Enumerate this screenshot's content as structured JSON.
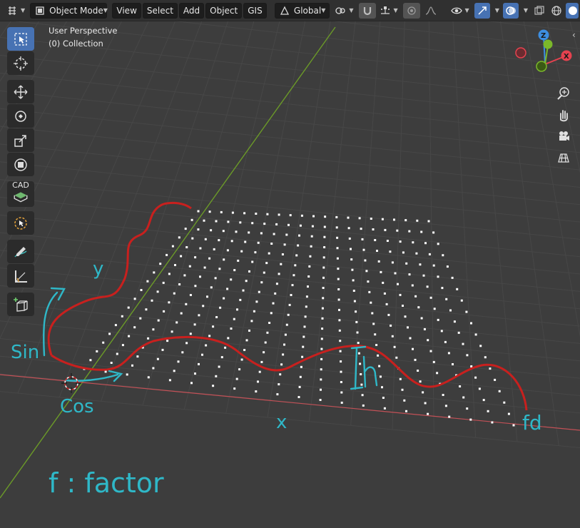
{
  "header": {
    "editor_type_icon": "viewport-icon",
    "mode": {
      "label": "Object Mode",
      "icon": "object-mode-icon"
    },
    "menus": [
      "View",
      "Select",
      "Add",
      "Object",
      "GIS"
    ],
    "transform_orientation": {
      "label": "Global",
      "icon": "orientation-icon"
    },
    "pivot_icon": "pivot-icon",
    "snap_icon": "magnet-icon",
    "snap_target_icon": "snap-grid-icon",
    "proportional_icon": "proportional-edit-icon",
    "falloff_icon": "falloff-curve-icon",
    "visibility_icon": "eye-icon",
    "gizmo_icon": "gizmo-icon",
    "overlay_icon": "overlay-icon",
    "xray_icon": "xray-icon",
    "wireframe_icon": "wireframe-shading-icon",
    "solid_icon": "solid-shading-icon"
  },
  "viewport": {
    "perspective_label": "User Perspective",
    "collection_label": "(0) Collection"
  },
  "toolbar": {
    "tools": [
      {
        "name": "select-box-tool",
        "icon": "select-box-icon",
        "active": true
      },
      {
        "name": "cursor-tool",
        "icon": "cursor-icon",
        "active": false
      },
      {
        "name": "move-tool",
        "icon": "move-icon",
        "active": false
      },
      {
        "name": "rotate-tool",
        "icon": "rotate-icon",
        "active": false
      },
      {
        "name": "scale-tool",
        "icon": "scale-icon",
        "active": false
      },
      {
        "name": "transform-tool",
        "icon": "transform-icon",
        "active": false
      },
      {
        "name": "cad-tool",
        "icon": "cad-icon",
        "label": "CAD",
        "active": false
      },
      {
        "name": "select-circle-tool",
        "icon": "select-circle-icon",
        "active": false
      },
      {
        "name": "annotate-tool",
        "icon": "annotate-icon",
        "active": false
      },
      {
        "name": "measure-tool",
        "icon": "measure-icon",
        "active": false
      },
      {
        "name": "add-cube-tool",
        "icon": "add-cube-icon",
        "active": false
      }
    ]
  },
  "navigation": {
    "gizmo_axes": {
      "z": "Z",
      "x": "X"
    },
    "buttons": [
      "zoom-icon",
      "pan-hand-icon",
      "camera-icon",
      "ortho-grid-icon"
    ]
  },
  "annotations": {
    "labels": [
      "y",
      "Sin",
      "Cos",
      "x",
      "h",
      "fd",
      "f : factor"
    ],
    "color": "#2fb8c8",
    "curve_color": "#c8201e"
  },
  "colors": {
    "accent": "#4772b3",
    "x_axis": "#c25056",
    "y_axis": "#6b9a28",
    "gizmo_x": "#e6424f",
    "gizmo_y": "#7bb82a",
    "gizmo_z": "#3d8ee0"
  }
}
